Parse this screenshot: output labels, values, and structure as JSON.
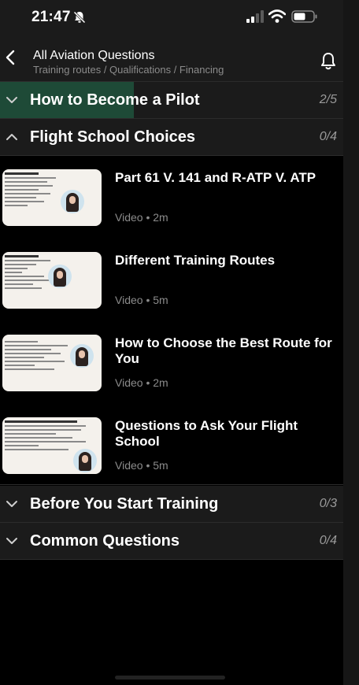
{
  "status_bar": {
    "time": "21:47"
  },
  "header": {
    "title": "All Aviation Questions",
    "subtitle": "Training routes / Qualifications / Financing",
    "back_icon": "chevron-left-icon",
    "notification_icon": "bell-icon"
  },
  "sections": [
    {
      "title": "How to Become a Pilot",
      "count": "2/5",
      "expanded": false,
      "progress": 0.4
    },
    {
      "title": "Flight School Choices",
      "count": "0/4",
      "expanded": true,
      "progress": 0
    },
    {
      "title": "Before You Start Training",
      "count": "0/3",
      "expanded": false,
      "progress": 0
    },
    {
      "title": "Common Questions",
      "count": "0/4",
      "expanded": false,
      "progress": 0
    }
  ],
  "lessons": [
    {
      "title": "Part 61 V. 141 and R-ATP V. ATP",
      "meta": "Video • 2m"
    },
    {
      "title": "Different Training Routes",
      "meta": "Video • 5m"
    },
    {
      "title": "How to Choose the Best Route for You",
      "meta": "Video • 2m"
    },
    {
      "title": "Questions to Ask Your Flight School",
      "meta": "Video • 5m"
    }
  ],
  "colors": {
    "progress": "#1e4a37",
    "header_bg": "#1b1b1b",
    "muted_text": "#8b8b8b"
  }
}
